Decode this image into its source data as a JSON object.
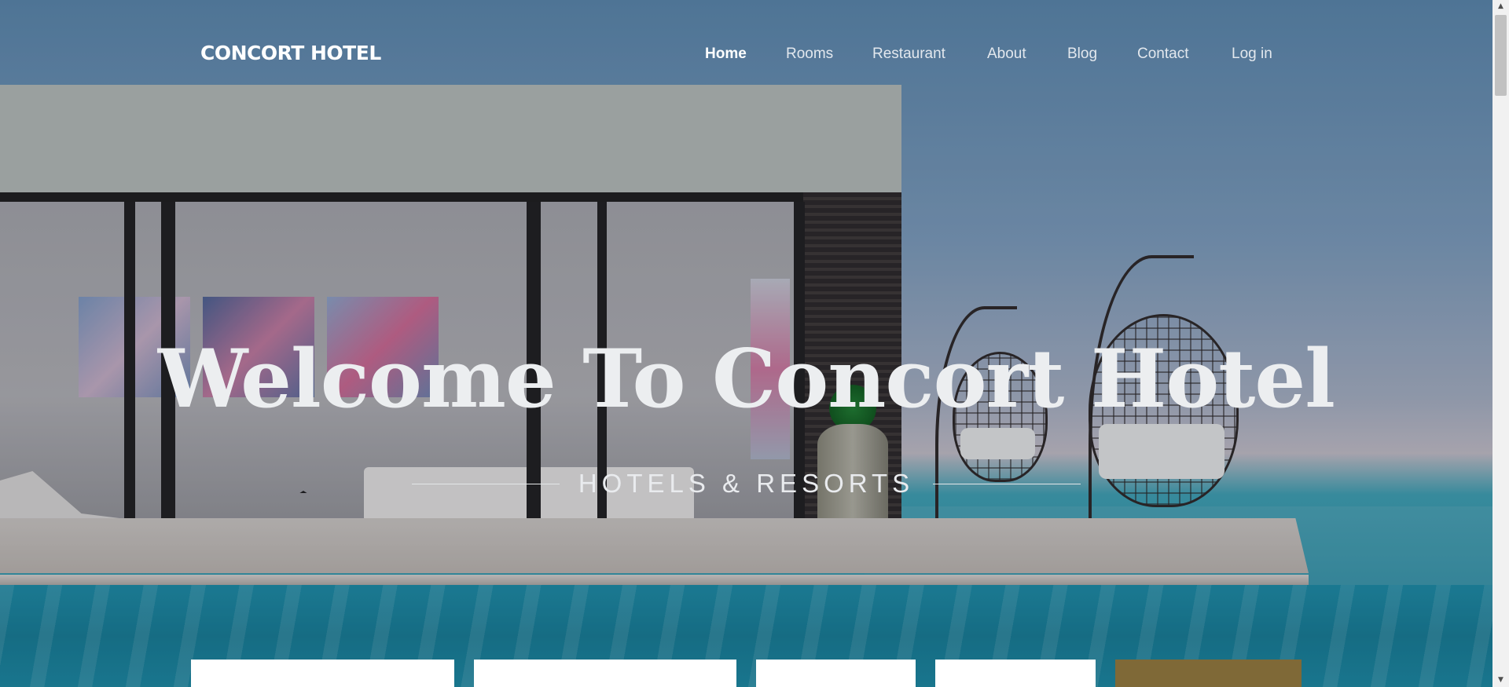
{
  "brand": {
    "name": "CONCORT HOTEL"
  },
  "nav": {
    "items": [
      {
        "label": "Home",
        "active": true
      },
      {
        "label": "Rooms",
        "active": false
      },
      {
        "label": "Restaurant",
        "active": false
      },
      {
        "label": "About",
        "active": false
      },
      {
        "label": "Blog",
        "active": false
      },
      {
        "label": "Contact",
        "active": false
      },
      {
        "label": "Log in",
        "active": false
      }
    ]
  },
  "hero": {
    "title": "Welcome To Concort Hotel",
    "subtitle": "HOTELS & RESORTS"
  },
  "booking": {
    "submit_color": "#7f6937"
  },
  "colors": {
    "accent": "#7f6937",
    "nav_text": "#e3e8ee",
    "brand_text": "#ffffff"
  }
}
